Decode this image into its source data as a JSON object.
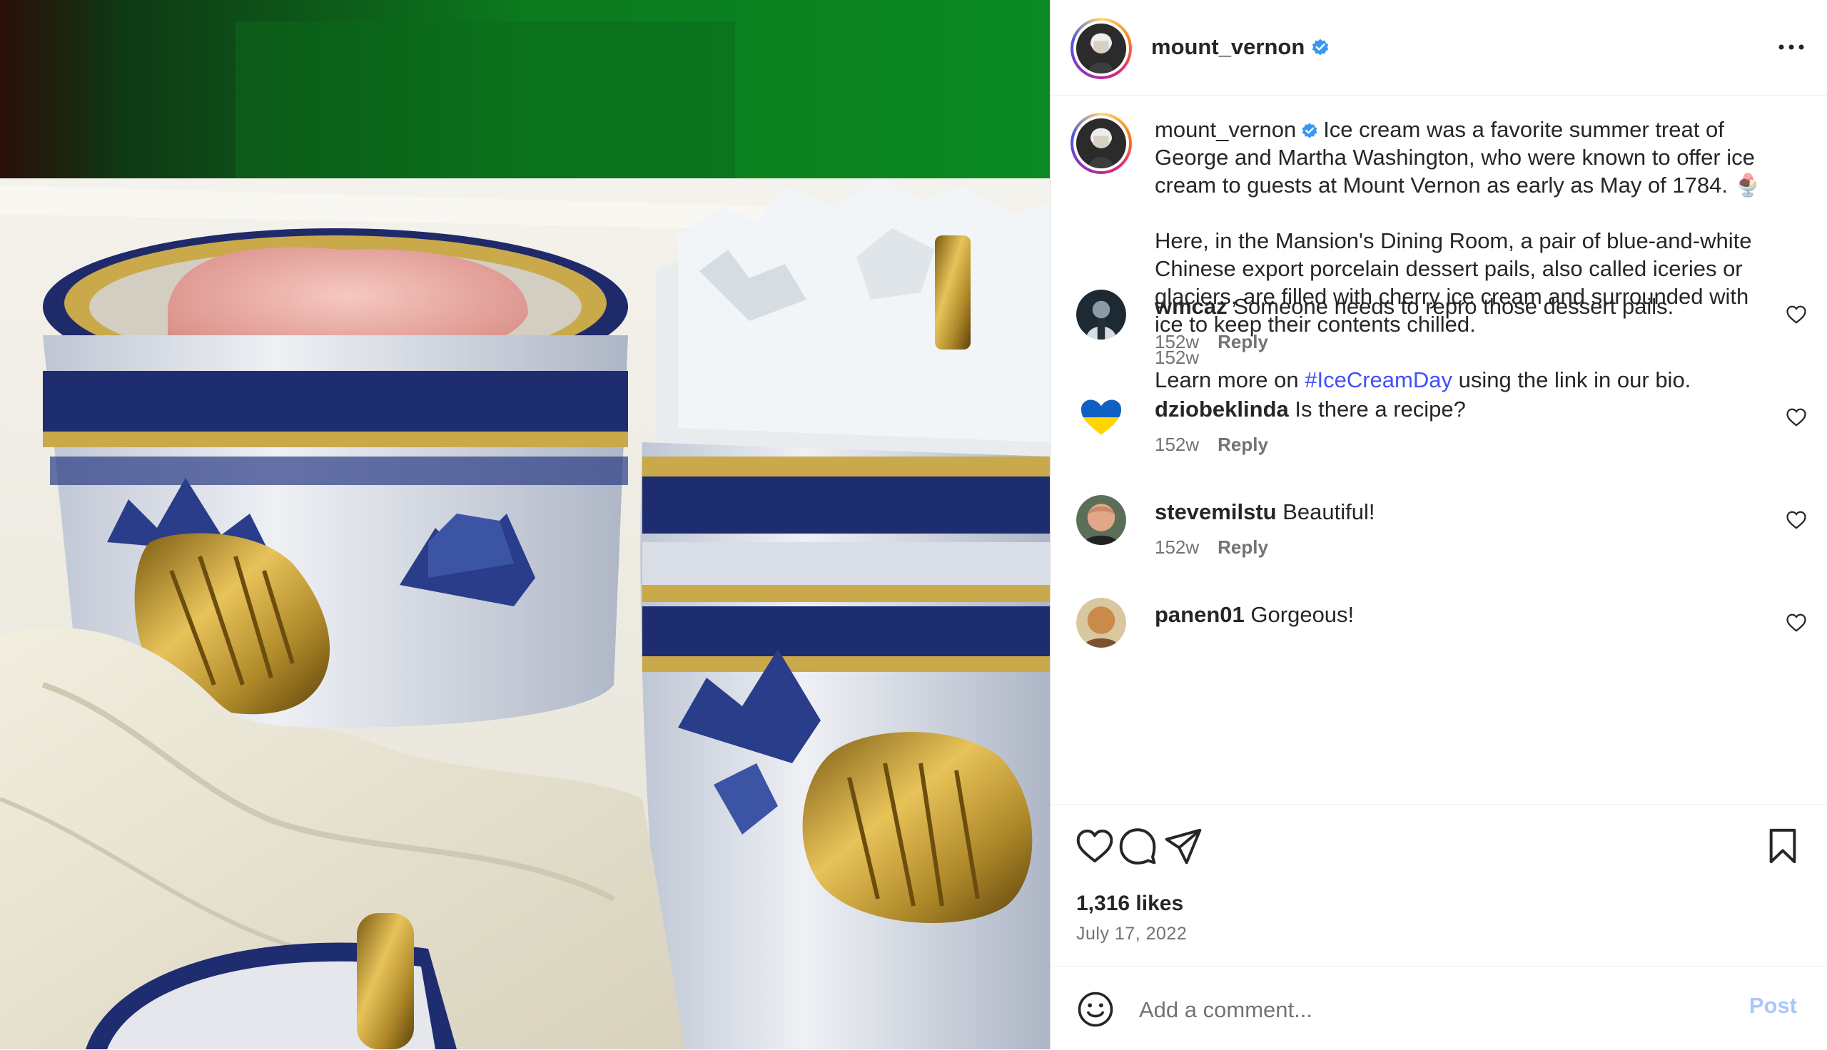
{
  "post": {
    "username": "mount_vernon",
    "verified_icon": "verified-badge-icon",
    "more_icon": "more-options-icon",
    "caption": {
      "username": "mount_vernon",
      "para1": "Ice cream was a favorite summer treat of George and Martha Washington, who were known to offer ice cream to guests at Mount Vernon as early as May of 1784. 🍨",
      "para2": "Here, in the Mansion's Dining Room, a pair of blue-and-white Chinese export porcelain dessert pails, also called iceries or glaciers, are filled with cherry ice cream and surrounded with ice to keep their contents chilled.",
      "para3_before": "Learn more on ",
      "para3_hashtag": "#IceCreamDay",
      "para3_after": " using the link in our bio.",
      "time": "152w"
    },
    "comments": [
      {
        "username": "wmcaz",
        "text": "Someone needs to repro those dessert pails.",
        "time": "152w",
        "reply": "Reply"
      },
      {
        "username": "dziobeklinda",
        "text": "Is there a recipe?",
        "time": "152w",
        "reply": "Reply"
      },
      {
        "username": "stevemilstu",
        "text": "Beautiful!",
        "time": "152w",
        "reply": "Reply"
      },
      {
        "username": "panen01",
        "text": "Gorgeous!"
      }
    ],
    "likes": "1,316 likes",
    "date": "July 17, 2022",
    "add_comment_placeholder": "Add a comment...",
    "post_button": "Post"
  },
  "colors": {
    "hashtag": "#4150f7",
    "verified": "#3897f0",
    "post_button": "#a8c7fa"
  }
}
